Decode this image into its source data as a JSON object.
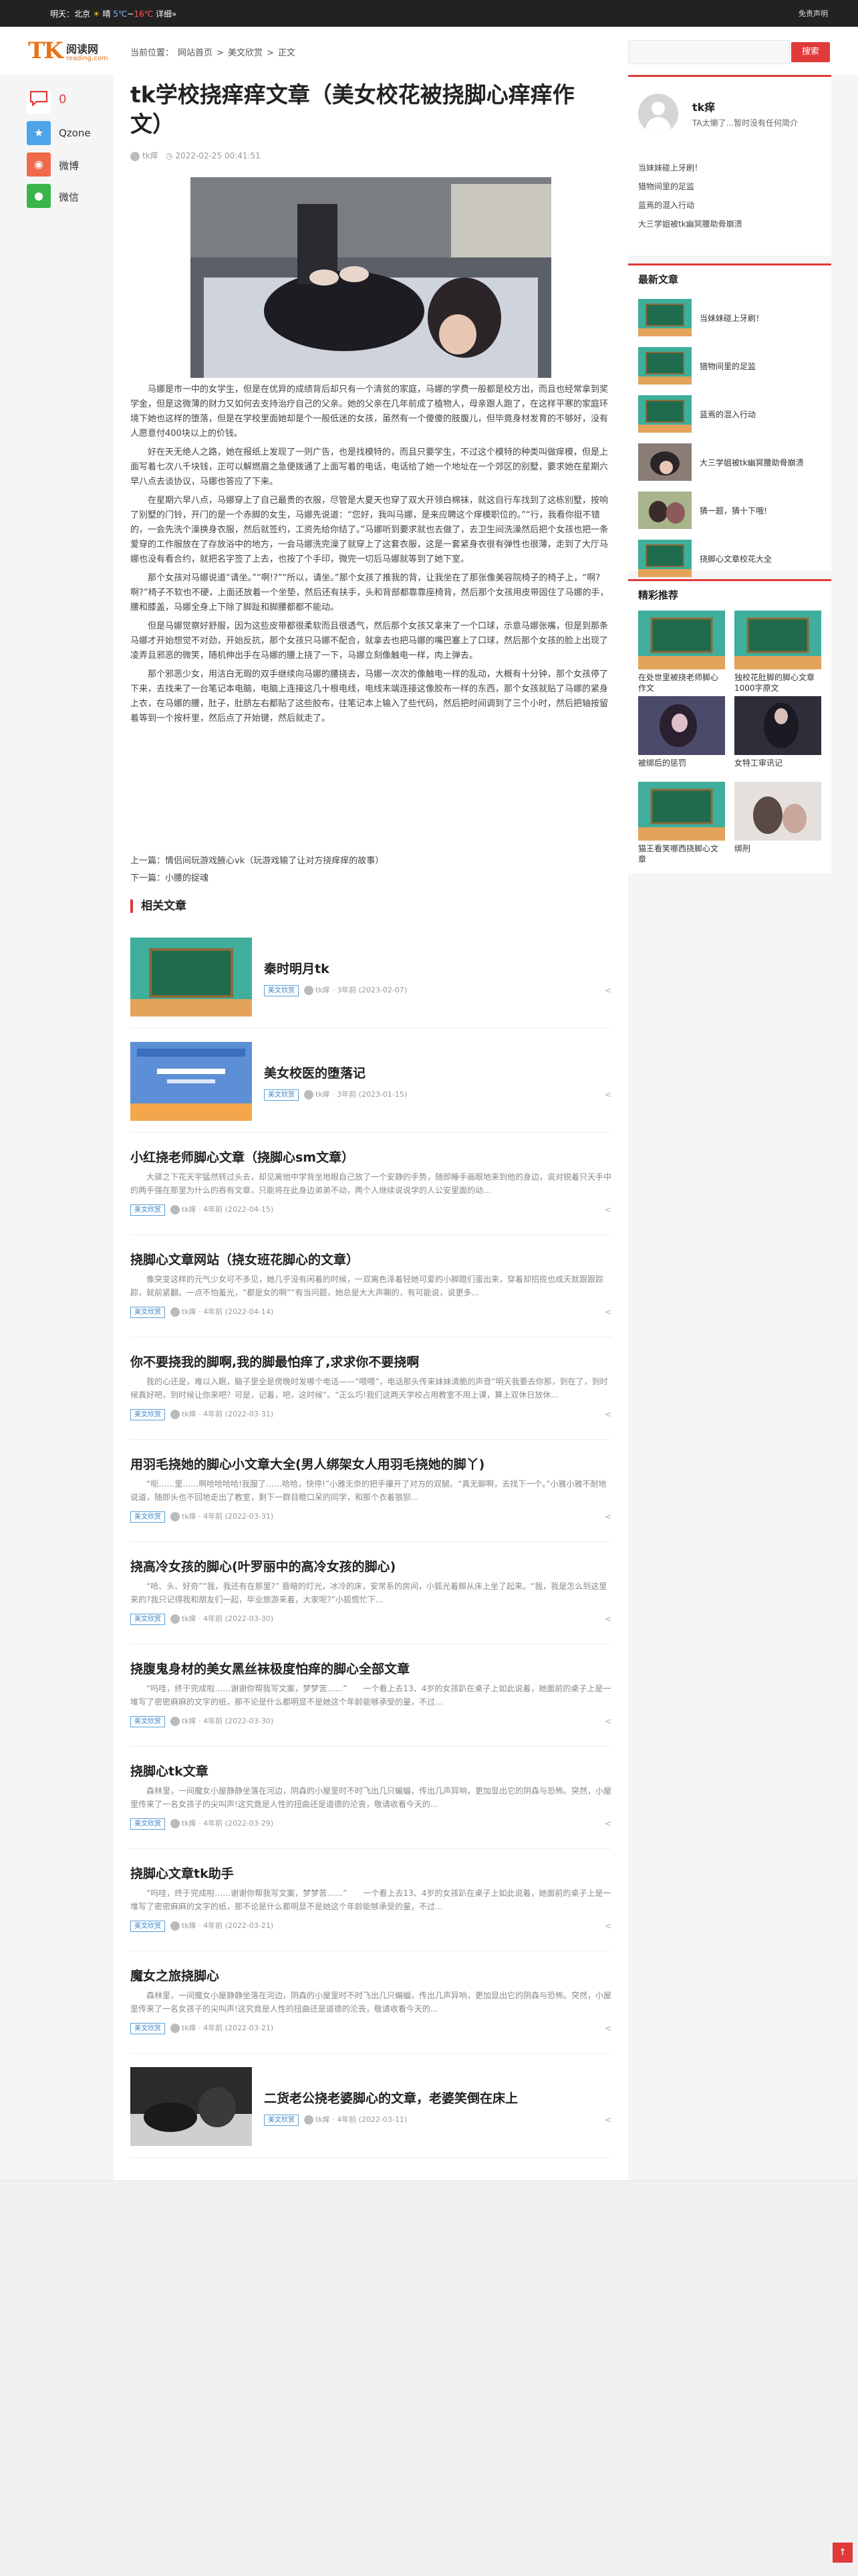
{
  "topbar": {
    "weather_prefix": "明天：北京",
    "weather_cond": "晴",
    "temp_low": "5℃",
    "temp_sep": "~",
    "temp_high": "16℃",
    "detail_link": "详细»",
    "disclaimer": "免责声明"
  },
  "header": {
    "logo_main": "TK",
    "logo_cn": "阅读网",
    "logo_url": "reading.com",
    "breadcrumb": [
      "当前位置：",
      "网站首页",
      ">",
      "美文欣赏",
      ">",
      "正文"
    ],
    "search_placeholder": "",
    "search_button": "搜索"
  },
  "share": {
    "comment_count": "0",
    "items": [
      {
        "label": "Qzone",
        "icon": "qzone-icon",
        "color": "#4da4e8"
      },
      {
        "label": "微博",
        "icon": "weibo-icon",
        "color": "#f06a4a"
      },
      {
        "label": "微信",
        "icon": "wechat-icon",
        "color": "#3ab54a"
      }
    ]
  },
  "article": {
    "title": "tk学校挠痒痒文章（美女校花被挠脚心痒痒作文）",
    "author": "tk痒",
    "date": "2022-02-25 00:41:51",
    "paragraphs": [
      "马娜是市一中的女学生，但是在优异的成绩背后却只有一个清贫的家庭，马娜的学费一般都是校方出，而且也经常拿到奖学金，但是这微薄的财力又如何去支持治疗自己的父亲。她的父亲在几年前成了植物人，母亲跟人跑了，在这样平寒的家庭环境下她也这样的堕落，但是在学校里面她却是个一般低迷的女孩，虽然有一个傻傻的肢腹儿，但毕竟身材发育的不够好，没有人愿意付400块以上的价钱。",
      "好在天无绝人之路，她在报纸上发现了一则广告，也是找模特的，而且只要学生，不过这个模特的种类叫做痒模，但是上面写着七次八千块钱，正可以解燃眉之急便拨通了上面写着的电话，电话给了她一个地址在一个郊区的别墅，要求她在星期六早八点去谈协议，马娜也答应了下来。",
      "在星期六早八点，马娜穿上了自己最贵的衣服，尽管是大夏天也穿了双大开领白棉袜，就这自行车找到了这栋别墅，按响了别墅的门铃，开门的是一个赤脚的女生，马娜先说道：“您好，我叫马娜，是来应聘这个痒模职位的。”“行，我看你挺不错的，一会先洗个澡换身衣服，然后就签约，工资先给你结了。”马娜听到要求就也去做了，去卫生间洗澡然后把个女孩也把一条爱穿的工作服放在了存放浴中的地方，一会马娜洗完澡了就穿上了这套衣服，这是一套紧身衣很有弹性也很薄，走到了大厅马娜也没有看合约，就把名字签了上去，也按了个手印，微完一切后马娜就等到了她下室。",
      "那个女孩对马娜说道“请坐。”“啊!?”“所以，请坐。”那个女孩了推我的背，让我坐在了那张像美容院椅子的椅子上，“啊?啊?”椅子不软也不硬，上面还放着一个坐垫，然后还有扶手，头和背部都靠靠座椅背，然后那个女孩用皮带固住了马娜的手，腰和膝盖，马娜全身上下除了脚趾和脚腰都都不能动。",
      "但是马娜觉察好舒服，因为这些皮带都很柔软而且很透气，然后那个女孩又拿来了一个口球，示意马娜张嘴，但是到那条马娜才开始想觉不对劲，开始反抗，那个女孩只马娜不配合，就拿去也把马娜的嘴巴塞上了口球，然后那个女孩的脸上出现了凌弄且邪恶的微笑，随机伸出手在马娜的腰上挠了一下，马娜立刻像触电一样，肉上弹去。",
      "那个邪恶少女，用洁白无瑕的双手继续向马娜的腰挠去，马娜一次次的像触电一样的乱动，大概有十分钟，那个女孩停了下来，去找来了一台笔记本电脑，电脑上连接这几十根电线，电线末端连接这像胶布一样的东西，那个女孩就贴了马娜的紧身上衣，在马娜的腰，肚子，肚脐左右都贴了这些胶布，往笔记本上输入了些代码，然后把时间调到了三个小时，然后把轴按留着等到一个按杆里，然后点了开始键，然后就走了。"
    ],
    "prev_label": "上一篇：",
    "prev_title": "情侣间玩游戏腋心vk（玩游戏输了让对方挠痒痒的故事）",
    "next_label": "下一篇：",
    "next_title": "小腰的捉魂",
    "related_heading": "相关文章"
  },
  "related": [
    {
      "title": "秦时明月tk",
      "tag": "美文欣赏",
      "author": "tk痒",
      "time": "3年前 (2023-02-07)",
      "thumb": "chalkboard"
    },
    {
      "title": "美女校医的堕落记",
      "tag": "美文欣赏",
      "author": "tk痒",
      "time": "3年前 (2023-01-15)",
      "thumb": "webpage"
    },
    {
      "title": "小红挠老师脚心文章（挠脚心sm文章）",
      "tag": "美文欣赏",
      "author": "tk痒",
      "time": "4年前 (2022-04-15)",
      "excerpt": "大驿之下花天宇猛然转过头去，却见离他中学背坐地眼自己放了一个安静的手势，随即睡手画眼地来到他的身边，说对锐着只天手中的两手强在那里为什么的吞有文章，只能将在此身边弟弟不动，两个人继续说说学的人公安里面的动..."
    },
    {
      "title": "挠脚心文章网站（挠女班花脚心的文章）",
      "tag": "美文欣赏",
      "author": "tk痒",
      "time": "4年前 (2022-04-14)",
      "excerpt": "像突变这样的元气少女可不多见，她几乎没有闲着的时候，一双离色泽着轻她可爱的小脚蹬们蛋出来，穿着却招揽也成天就跟跟踪踪，就前紧翻。一点不怕羞光，“都是女的啊”“有当问题，她总是大大声唰的，有可能说，说更多..."
    },
    {
      "title": "你不要挠我的脚啊,我的脚最怕痒了,求求你不要挠啊",
      "tag": "美文欣赏",
      "author": "tk痒",
      "time": "4年前 (2022-03-31)",
      "excerpt": "我的心还是，难以入眠，脑子里全是傍晚时发哪个电话——“喂喂”，电话那头传来妹妹清脆的声音“明天我要去你那，到在了，到时候真好吧，到时候让你来吧？可是，记着，吧，这时候”。“正么巧!我们这两天学校占用教室不用上课，算上双休日放休..."
    },
    {
      "title": "用羽毛挠她的脚心小文章大全(男人绑架女人用羽毛挠她的脚丫)",
      "tag": "美文欣赏",
      "author": "tk痒",
      "time": "4年前 (2022-03-31)",
      "excerpt": "“呃……里……啊哈哈哈哈!我服了……哈哈，快停!”小雅无奈的把手攥开了对方的双腿。“真无聊啊，去找下一个。”小雅小雅不耐地说道，随即头也不回地走出了教室，剩下一群目瞪口呆的同学，和那个衣着狼狈..."
    },
    {
      "title": "挠高冷女孩的脚心(叶罗丽中的高冷女孩的脚心)",
      "tag": "美文欣赏",
      "author": "tk痒",
      "time": "4年前 (2022-03-30)",
      "excerpt": "“哈、头、好奇”“我，我还有在那里?” 昏暗的灯光，冰冷的床，安常系的房间，小狐光着脚从床上坐了起来。“我，我是怎么到这里来的?我只记得我和朋友们一起，毕业旅游来着，大家呢?”小狐慌忙下..."
    },
    {
      "title": "挠腹鬼身材的美女黑丝袜极度怕痒的脚心全部文章",
      "tag": "美文欣赏",
      "author": "tk痒",
      "time": "4年前 (2022-03-30)",
      "excerpt": "“吗哇，终于完成啦……谢谢你帮我写文案，梦梦苦……”　　一个看上去13、4岁的女孩趴在桌子上如此说着，她面前的桌子上是一堆写了密密麻麻的文字的纸，那不论是什么都明显不是她这个年龄能够承受的量，不过..."
    },
    {
      "title": "挠脚心tk文章",
      "tag": "美文欣赏",
      "author": "tk痒",
      "time": "4年前 (2022-03-29)",
      "excerpt": "森林里，一间魔女小屋静静坐落在河边，阴森的小屋里时不时飞出几只蝙蝠，传出几声异响，更加显出它的阴森与恐怖。突然，小屋里传来了一名女孩子的尖叫声!这究竟是人性的扭曲还是道德的沦丧，敬请收看今天的..."
    },
    {
      "title": "挠脚心文章tk助手",
      "tag": "美文欣赏",
      "author": "tk痒",
      "time": "4年前 (2022-03-21)",
      "excerpt": "“吗哇，终于完成啦……谢谢你帮我写文案，梦梦苦……”　　一个看上去13、4岁的女孩趴在桌子上如此说着，她面前的桌子上是一堆写了密密麻麻的文字的纸，那不论是什么都明显不是她这个年龄能够承受的量，不过..."
    },
    {
      "title": "魔女之旅挠脚心",
      "tag": "美文欣赏",
      "author": "tk痒",
      "time": "4年前 (2022-03-21)",
      "excerpt": "森林里，一间魔女小屋静静坐落在河边，阴森的小屋里时不时飞出几只蝙蝠，传出几声异响，更加显出它的阴森与恐怖。突然，小屋里传来了一名女孩子的尖叫声!这究竟是人性的扭曲还是道德的沦丧，敬请收看今天的..."
    },
    {
      "title": "二货老公挠老婆脚心的文章，老婆笑倒在床上",
      "tag": "美文欣赏",
      "author": "tk痒",
      "time": "4年前 (2022-03-11)",
      "thumb": "photo"
    }
  ],
  "sidebar": {
    "user_name": "tk痒",
    "user_bio": "TA太懒了...暂时没有任何简介",
    "user_links": [
      "当妹妹碰上牙刷！",
      "猎物间里的足监",
      "蓝焉的混入行动",
      "大三学姐被tk幽冥腰助骨崩溃"
    ],
    "latest_heading": "最新文章",
    "latest": [
      {
        "title": "当妹妹碰上牙刷！",
        "thumb": "chalkboard"
      },
      {
        "title": "猎物间里的足监",
        "thumb": "chalkboard"
      },
      {
        "title": "蓝焉的混入行动",
        "thumb": "chalkboard"
      },
      {
        "title": "大三学姐被tk幽冥腰助骨崩溃",
        "thumb": "photo"
      },
      {
        "title": "猜一题，猜十下哦!",
        "thumb": "photo"
      },
      {
        "title": "挠脚心文章校花大全",
        "thumb": "chalkboard"
      }
    ],
    "recommend_heading": "精彩推荐",
    "recommend": [
      {
        "title": "在处世里被挠老师脚心作文",
        "thumb": "chalkboard"
      },
      {
        "title": "独校花肚脚的脚心文章1000字原文",
        "thumb": "chalkboard"
      },
      {
        "title": "被绑后的惩罚",
        "thumb": "photo"
      },
      {
        "title": "女特工审讯记",
        "thumb": "photo"
      },
      {
        "title": "猫王看笑哪西挠脚心文章",
        "thumb": "chalkboard"
      },
      {
        "title": "绑刑",
        "thumb": "photo"
      }
    ]
  },
  "back_to_top": "↑",
  "colors": {
    "accent": "#e03a3a",
    "logo": "#e8731a",
    "tag": "#3a85c7"
  }
}
